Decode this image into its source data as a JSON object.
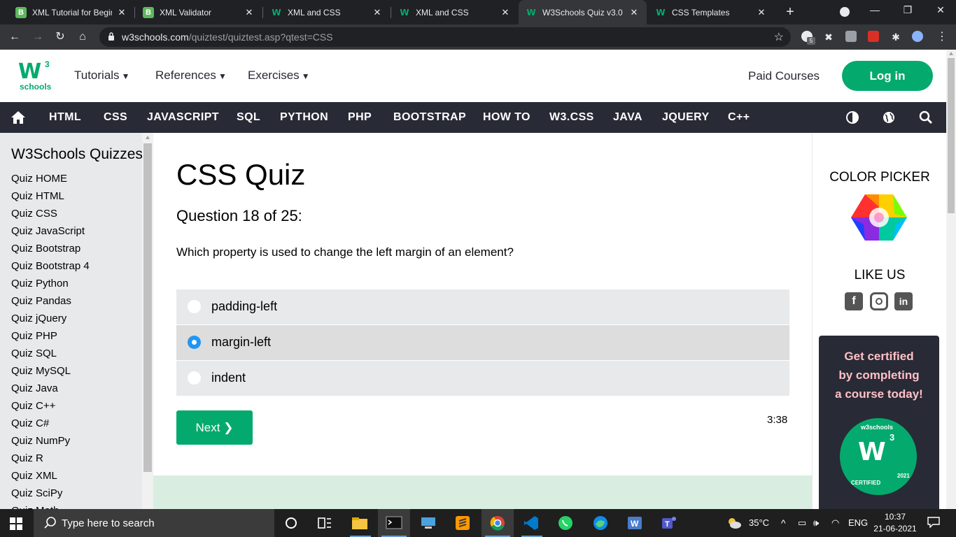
{
  "browser": {
    "tabs": [
      {
        "title": "XML Tutorial for Beginn",
        "favicon": "B"
      },
      {
        "title": "XML Validator",
        "favicon": "B"
      },
      {
        "title": "XML and CSS",
        "favicon": "w3"
      },
      {
        "title": "XML and CSS",
        "favicon": "w3"
      },
      {
        "title": "W3Schools Quiz v3.0",
        "favicon": "w3",
        "active": true
      },
      {
        "title": "CSS Templates",
        "favicon": "w3"
      }
    ],
    "url_domain": "w3schools.com",
    "url_path": "/quiztest/quiztest.asp?qtest=CSS",
    "extension_badge": "5"
  },
  "header": {
    "logo_text": "schools",
    "logo_mark": "W",
    "logo_sup": "3",
    "menus": [
      "Tutorials",
      "References",
      "Exercises"
    ],
    "paid_courses": "Paid Courses",
    "login": "Log in"
  },
  "navbar": {
    "items": [
      "HTML",
      "CSS",
      "JAVASCRIPT",
      "SQL",
      "PYTHON",
      "PHP",
      "BOOTSTRAP",
      "HOW TO",
      "W3.CSS",
      "JAVA",
      "JQUERY",
      "C++"
    ]
  },
  "sidebar": {
    "title": "W3Schools Quizzes",
    "items": [
      "Quiz HOME",
      "Quiz HTML",
      "Quiz CSS",
      "Quiz JavaScript",
      "Quiz Bootstrap",
      "Quiz Bootstrap 4",
      "Quiz Python",
      "Quiz Pandas",
      "Quiz jQuery",
      "Quiz PHP",
      "Quiz SQL",
      "Quiz MySQL",
      "Quiz Java",
      "Quiz C++",
      "Quiz C#",
      "Quiz NumPy",
      "Quiz R",
      "Quiz XML",
      "Quiz SciPy",
      "Quiz Math"
    ]
  },
  "quiz": {
    "title": "CSS Quiz",
    "progress": "Question 18 of 25:",
    "question": "Which property is used to change the left margin of an element?",
    "options": [
      {
        "label": "padding-left",
        "selected": false
      },
      {
        "label": "margin-left",
        "selected": true
      },
      {
        "label": "indent",
        "selected": false
      }
    ],
    "next": "Next ❯",
    "timer": "3:38"
  },
  "right": {
    "color_picker": "COLOR PICKER",
    "like_us": "LIKE US",
    "social": [
      "facebook-icon",
      "instagram-icon",
      "linkedin-icon"
    ],
    "cert_line1": "Get certified",
    "cert_line2": "by completing",
    "cert_line3": "a course today!",
    "badge_top": "w3schools",
    "badge_bottom": "CERTIFIED",
    "badge_year": "2021"
  },
  "taskbar": {
    "search_placeholder": "Type here to search",
    "weather": "35°C",
    "language": "ENG",
    "time": "10:37",
    "date": "21-06-2021"
  },
  "colors": {
    "accent": "#04aa6d",
    "navbar": "#282a35",
    "sidebar": "#e7e9eb",
    "radio_selected": "#2196f3"
  }
}
